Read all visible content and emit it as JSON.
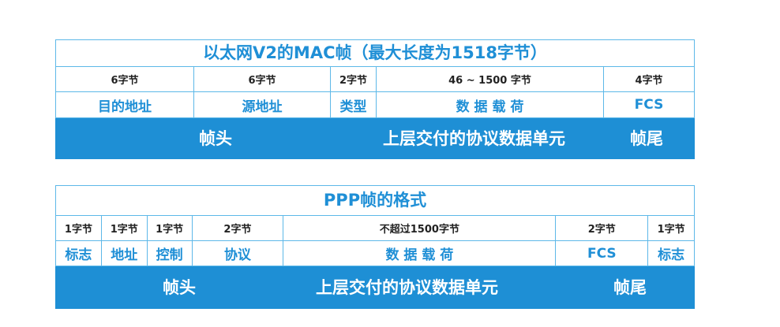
{
  "mac": {
    "title": "以太网V2的MAC帧（最大长度为1518字节）",
    "sizes": [
      "6字节",
      "6字节",
      "2字节",
      "46 ~ 1500 字节",
      "4字节"
    ],
    "fields": [
      "目的地址",
      "源地址",
      "类型",
      "数 据 载 荷",
      "FCS"
    ],
    "band": {
      "head": "帧头",
      "payload": "上层交付的协议数据单元",
      "tail": "帧尾"
    }
  },
  "ppp": {
    "title": "PPP帧的格式",
    "sizes": [
      "1字节",
      "1字节",
      "1字节",
      "2字节",
      "不超过1500字节",
      "2字节",
      "1字节"
    ],
    "fields": [
      "标志",
      "地址",
      "控制",
      "协议",
      "数 据 载 荷",
      "FCS",
      "标志"
    ],
    "band": {
      "head": "帧头",
      "payload": "上层交付的协议数据单元",
      "tail": "帧尾"
    }
  },
  "colors": {
    "accent": "#1f8fd6",
    "band": "#1e8fd5",
    "border": "#5db8e8"
  }
}
